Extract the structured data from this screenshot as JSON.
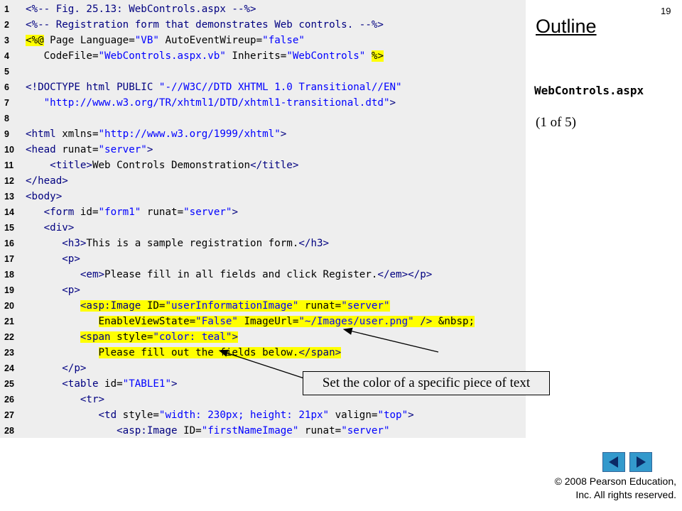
{
  "slide": {
    "page_number": "19",
    "outline_title": "Outline",
    "file_name": "WebControls.aspx",
    "page_indicator": "(1 of 5)",
    "callout": "Set the color of a specific piece of text",
    "copyright_line1": "© 2008 Pearson Education,",
    "copyright_line2": "Inc.  All rights reserved.",
    "nav": {
      "prev_icon": "triangle-left-icon",
      "next_icon": "triangle-right-icon"
    }
  },
  "colors": {
    "code_bg": "#eeeeee",
    "highlight": "#ffff00",
    "tag": "#000080",
    "value": "#0000ff",
    "nav_button": "#3399cc"
  },
  "code_lines": [
    {
      "n": "1",
      "highlight": false,
      "tokens": [
        [
          "tag",
          "<%-- Fig. 25.13: WebControls.aspx --%>"
        ]
      ]
    },
    {
      "n": "2",
      "highlight": false,
      "tokens": [
        [
          "tag",
          "<%-- Registration form that demonstrates Web controls. --%>"
        ]
      ]
    },
    {
      "n": "3",
      "highlight": false,
      "tokens": [
        [
          "dir",
          "<%@"
        ],
        [
          "attr",
          " Page Language"
        ],
        [
          "text",
          "="
        ],
        [
          "val",
          "\"VB\""
        ],
        [
          "attr",
          " AutoEventWireup"
        ],
        [
          "text",
          "="
        ],
        [
          "val",
          "\"false\""
        ]
      ]
    },
    {
      "n": "4",
      "highlight": false,
      "tokens": [
        [
          "attr",
          "   CodeFile"
        ],
        [
          "text",
          "="
        ],
        [
          "val",
          "\"WebControls.aspx.vb\""
        ],
        [
          "attr",
          " Inherits"
        ],
        [
          "text",
          "="
        ],
        [
          "val",
          "\"WebControls\""
        ],
        [
          "text",
          " "
        ],
        [
          "dir",
          "%>"
        ]
      ]
    },
    {
      "n": "5",
      "highlight": false,
      "tokens": []
    },
    {
      "n": "6",
      "highlight": false,
      "tokens": [
        [
          "tag",
          "<!DOCTYPE html PUBLIC "
        ],
        [
          "val",
          "\"-//W3C//DTD XHTML 1.0 Transitional//EN\""
        ]
      ]
    },
    {
      "n": "7",
      "highlight": false,
      "tokens": [
        [
          "text",
          "   "
        ],
        [
          "val",
          "\"http://www.w3.org/TR/xhtml1/DTD/xhtml1-transitional.dtd\""
        ],
        [
          "tag",
          ">"
        ]
      ]
    },
    {
      "n": "8",
      "highlight": false,
      "tokens": []
    },
    {
      "n": "9",
      "highlight": false,
      "tokens": [
        [
          "tag",
          "<html"
        ],
        [
          "attr",
          " xmlns"
        ],
        [
          "text",
          "="
        ],
        [
          "val",
          "\"http://www.w3.org/1999/xhtml\""
        ],
        [
          "tag",
          ">"
        ]
      ]
    },
    {
      "n": "10",
      "highlight": false,
      "tokens": [
        [
          "tag",
          "<head"
        ],
        [
          "attr",
          " runat"
        ],
        [
          "text",
          "="
        ],
        [
          "val",
          "\"server\""
        ],
        [
          "tag",
          ">"
        ]
      ]
    },
    {
      "n": "11",
      "highlight": false,
      "tokens": [
        [
          "text",
          "    "
        ],
        [
          "tag",
          "<title>"
        ],
        [
          "text",
          "Web Controls Demonstration"
        ],
        [
          "tag",
          "</title>"
        ]
      ]
    },
    {
      "n": "12",
      "highlight": false,
      "tokens": [
        [
          "tag",
          "</head>"
        ]
      ]
    },
    {
      "n": "13",
      "highlight": false,
      "tokens": [
        [
          "tag",
          "<body>"
        ]
      ]
    },
    {
      "n": "14",
      "highlight": false,
      "tokens": [
        [
          "text",
          "   "
        ],
        [
          "tag",
          "<form"
        ],
        [
          "attr",
          " id"
        ],
        [
          "text",
          "="
        ],
        [
          "val",
          "\"form1\""
        ],
        [
          "attr",
          " runat"
        ],
        [
          "text",
          "="
        ],
        [
          "val",
          "\"server\""
        ],
        [
          "tag",
          ">"
        ]
      ]
    },
    {
      "n": "15",
      "highlight": false,
      "tokens": [
        [
          "text",
          "   "
        ],
        [
          "tag",
          "<div>"
        ]
      ]
    },
    {
      "n": "16",
      "highlight": false,
      "tokens": [
        [
          "text",
          "      "
        ],
        [
          "tag",
          "<h3>"
        ],
        [
          "text",
          "This is a sample registration form."
        ],
        [
          "tag",
          "</h3>"
        ]
      ]
    },
    {
      "n": "17",
      "highlight": false,
      "tokens": [
        [
          "text",
          "      "
        ],
        [
          "tag",
          "<p>"
        ]
      ]
    },
    {
      "n": "18",
      "highlight": false,
      "tokens": [
        [
          "text",
          "         "
        ],
        [
          "tag",
          "<em>"
        ],
        [
          "text",
          "Please fill in all fields and click Register."
        ],
        [
          "tag",
          "</em></p>"
        ]
      ]
    },
    {
      "n": "19",
      "highlight": false,
      "tokens": [
        [
          "text",
          "      "
        ],
        [
          "tag",
          "<p>"
        ]
      ]
    },
    {
      "n": "20",
      "highlight": true,
      "tokens": [
        [
          "text",
          "         "
        ],
        [
          "tag",
          "<asp:Image"
        ],
        [
          "attr",
          " ID"
        ],
        [
          "text",
          "="
        ],
        [
          "val",
          "\"userInformationImage\""
        ],
        [
          "attr",
          " runat"
        ],
        [
          "text",
          "="
        ],
        [
          "val",
          "\"server\""
        ]
      ]
    },
    {
      "n": "21",
      "highlight": true,
      "tokens": [
        [
          "text",
          "            "
        ],
        [
          "attr",
          "EnableViewState"
        ],
        [
          "text",
          "="
        ],
        [
          "val",
          "\"False\""
        ],
        [
          "attr",
          " ImageUrl"
        ],
        [
          "text",
          "="
        ],
        [
          "val",
          "\"~/Images/user.png\""
        ],
        [
          "tag",
          " />"
        ],
        [
          "text",
          " &nbsp;"
        ]
      ]
    },
    {
      "n": "22",
      "highlight": true,
      "tokens": [
        [
          "text",
          "         "
        ],
        [
          "tag",
          "<span"
        ],
        [
          "attr",
          " style"
        ],
        [
          "text",
          "="
        ],
        [
          "val",
          "\"color: teal\""
        ],
        [
          "tag",
          ">"
        ]
      ]
    },
    {
      "n": "23",
      "highlight": true,
      "tokens": [
        [
          "text",
          "            Please fill out the fields below."
        ],
        [
          "tag",
          "</span>"
        ]
      ]
    },
    {
      "n": "24",
      "highlight": false,
      "tokens": [
        [
          "text",
          "      "
        ],
        [
          "tag",
          "</p>"
        ]
      ]
    },
    {
      "n": "25",
      "highlight": false,
      "tokens": [
        [
          "text",
          "      "
        ],
        [
          "tag",
          "<table"
        ],
        [
          "attr",
          " id"
        ],
        [
          "text",
          "="
        ],
        [
          "val",
          "\"TABLE1\""
        ],
        [
          "tag",
          ">"
        ]
      ]
    },
    {
      "n": "26",
      "highlight": false,
      "tokens": [
        [
          "text",
          "         "
        ],
        [
          "tag",
          "<tr>"
        ]
      ]
    },
    {
      "n": "27",
      "highlight": false,
      "tokens": [
        [
          "text",
          "            "
        ],
        [
          "tag",
          "<td"
        ],
        [
          "attr",
          " style"
        ],
        [
          "text",
          "="
        ],
        [
          "val",
          "\"width: 230px; height: 21px\""
        ],
        [
          "attr",
          " valign"
        ],
        [
          "text",
          "="
        ],
        [
          "val",
          "\"top\""
        ],
        [
          "tag",
          ">"
        ]
      ]
    },
    {
      "n": "28",
      "highlight": false,
      "tokens": [
        [
          "text",
          "               "
        ],
        [
          "tag",
          "<asp:Image"
        ],
        [
          "attr",
          " ID"
        ],
        [
          "text",
          "="
        ],
        [
          "val",
          "\"firstNameImage\""
        ],
        [
          "attr",
          " runat"
        ],
        [
          "text",
          "="
        ],
        [
          "val",
          "\"server\""
        ]
      ]
    }
  ]
}
